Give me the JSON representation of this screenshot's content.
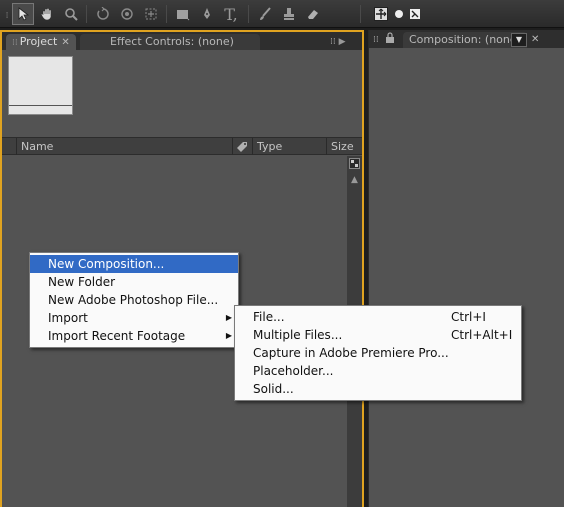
{
  "toolbar": {
    "tools": [
      "selection-tool",
      "hand-tool",
      "zoom-tool",
      "rotate-tool",
      "orbit-camera-tool",
      "pan-behind-tool",
      "rectangle-mask-tool",
      "pen-tool",
      "text-tool",
      "brush-tool",
      "clone-stamp-tool",
      "eraser-tool"
    ],
    "right_icons": [
      "move-axis-icon",
      "world-axis-icon",
      "view-axis-icon"
    ],
    "text_tool_glyph": "T,"
  },
  "project_panel": {
    "tab_project": "Project",
    "tab_effect_controls": "Effect Controls: (none)",
    "columns": {
      "name": "Name",
      "type": "Type",
      "size": "Size"
    }
  },
  "comp_panel": {
    "tab_composition": "Composition: (none)"
  },
  "context_menu": {
    "items": [
      {
        "label": "New Composition...",
        "submenu": false,
        "highlighted": true
      },
      {
        "label": "New Folder",
        "submenu": false,
        "highlighted": false
      },
      {
        "label": "New Adobe Photoshop File...",
        "submenu": false,
        "highlighted": false
      },
      {
        "label": "Import",
        "submenu": true,
        "highlighted": false
      },
      {
        "label": "Import Recent Footage",
        "submenu": true,
        "highlighted": false
      }
    ]
  },
  "import_submenu": {
    "items": [
      {
        "label": "File...",
        "shortcut": "Ctrl+I"
      },
      {
        "label": "Multiple Files...",
        "shortcut": "Ctrl+Alt+I"
      },
      {
        "label": "Capture in Adobe Premiere Pro...",
        "shortcut": ""
      },
      {
        "label": "Placeholder...",
        "shortcut": ""
      },
      {
        "label": "Solid...",
        "shortcut": ""
      }
    ]
  },
  "colors": {
    "panel_bg": "#535353",
    "active_panel_border": "#e0a320",
    "menu_highlight": "#316ac5"
  }
}
